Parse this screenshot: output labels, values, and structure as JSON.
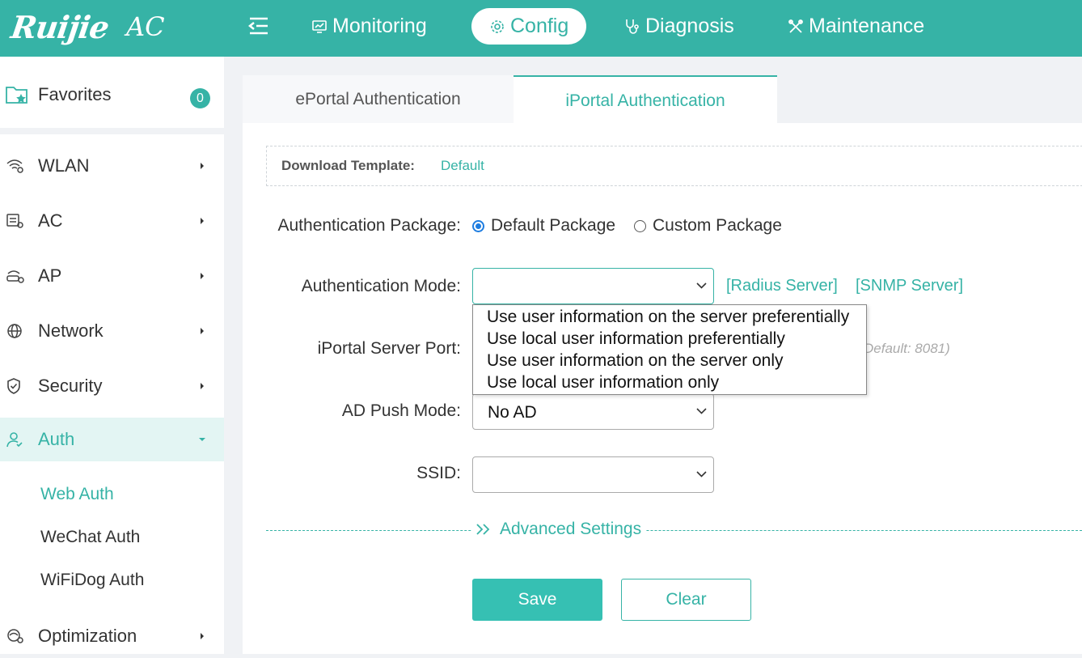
{
  "header": {
    "brand": "Ruijie",
    "product": "AC",
    "nav": [
      {
        "label": "Monitoring",
        "icon": "monitor-icon"
      },
      {
        "label": "Config",
        "icon": "gear-icon",
        "active": true
      },
      {
        "label": "Diagnosis",
        "icon": "stethoscope-icon"
      },
      {
        "label": "Maintenance",
        "icon": "tools-icon"
      }
    ]
  },
  "sidebar": {
    "favorites": {
      "label": "Favorites",
      "count": "0"
    },
    "items": [
      {
        "label": "WLAN",
        "icon": "wifi-settings-icon"
      },
      {
        "label": "AC",
        "icon": "ac-device-icon"
      },
      {
        "label": "AP",
        "icon": "ap-device-icon"
      },
      {
        "label": "Network",
        "icon": "globe-icon"
      },
      {
        "label": "Security",
        "icon": "shield-icon"
      },
      {
        "label": "Auth",
        "icon": "user-icon",
        "expanded": true
      },
      {
        "label": "Optimization",
        "icon": "optimize-icon"
      }
    ],
    "auth_subitems": [
      {
        "label": "Web Auth",
        "active": true
      },
      {
        "label": "WeChat Auth"
      },
      {
        "label": "WiFiDog Auth"
      }
    ]
  },
  "tabs": [
    {
      "label": "ePortal Authentication"
    },
    {
      "label": "iPortal Authentication",
      "active": true
    }
  ],
  "template": {
    "label": "Download Template:",
    "link": "Default"
  },
  "form": {
    "auth_package": {
      "label": "Authentication Package:",
      "options": [
        "Default Package",
        "Custom Package"
      ],
      "selected": "Default Package"
    },
    "auth_mode": {
      "label": "Authentication Mode:",
      "value": "",
      "links": [
        "[Radius Server]",
        "[SNMP Server]"
      ],
      "options": [
        "Use user information on the server preferentially",
        "Use local user information preferentially",
        "Use user information on the server only",
        "Use local user information only"
      ]
    },
    "server_port": {
      "label": "iPortal Server Port:",
      "hint": "Default: 8081)"
    },
    "ad_push_mode": {
      "label": "AD Push Mode:",
      "value": "No AD"
    },
    "ssid": {
      "label": "SSID:",
      "value": ""
    }
  },
  "advanced": {
    "label": "Advanced Settings"
  },
  "buttons": {
    "save": "Save",
    "clear": "Clear"
  },
  "colors": {
    "primary": "#36b3a6",
    "radio": "#1e7de0"
  }
}
